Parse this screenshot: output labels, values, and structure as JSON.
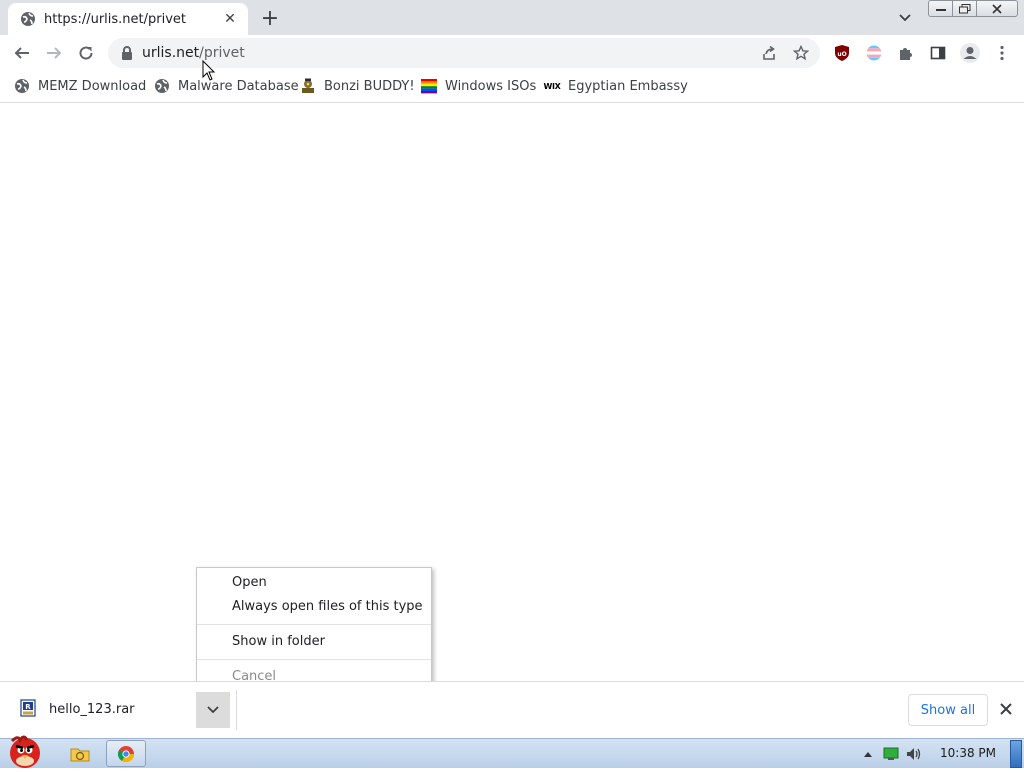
{
  "tab": {
    "title": "https://urlis.net/privet"
  },
  "omnibox": {
    "host": "urlis.net",
    "path": "/privet"
  },
  "bookmarks": [
    {
      "label": "MEMZ Download",
      "icon": "globe-icon"
    },
    {
      "label": "Malware Database",
      "icon": "globe-icon"
    },
    {
      "label": "Bonzi BUDDY!",
      "icon": "bonzi-icon"
    },
    {
      "label": "Windows ISOs",
      "icon": "rainbow-flag-icon"
    },
    {
      "label": "Egyptian Embassy",
      "icon": "wix-icon"
    }
  ],
  "bookmark_wix_text": "WIX",
  "context_menu": {
    "open": "Open",
    "always_open": "Always open files of this type",
    "show_in_folder": "Show in folder",
    "cancel": "Cancel"
  },
  "download": {
    "filename": "hello_123.rar"
  },
  "shelf": {
    "show_all": "Show all"
  },
  "taskbar": {
    "clock": "10:38 PM"
  },
  "colors": {
    "accent": "#1a73e8",
    "tabstrip": "#dee1e6",
    "omnibox": "#f1f3f4"
  }
}
